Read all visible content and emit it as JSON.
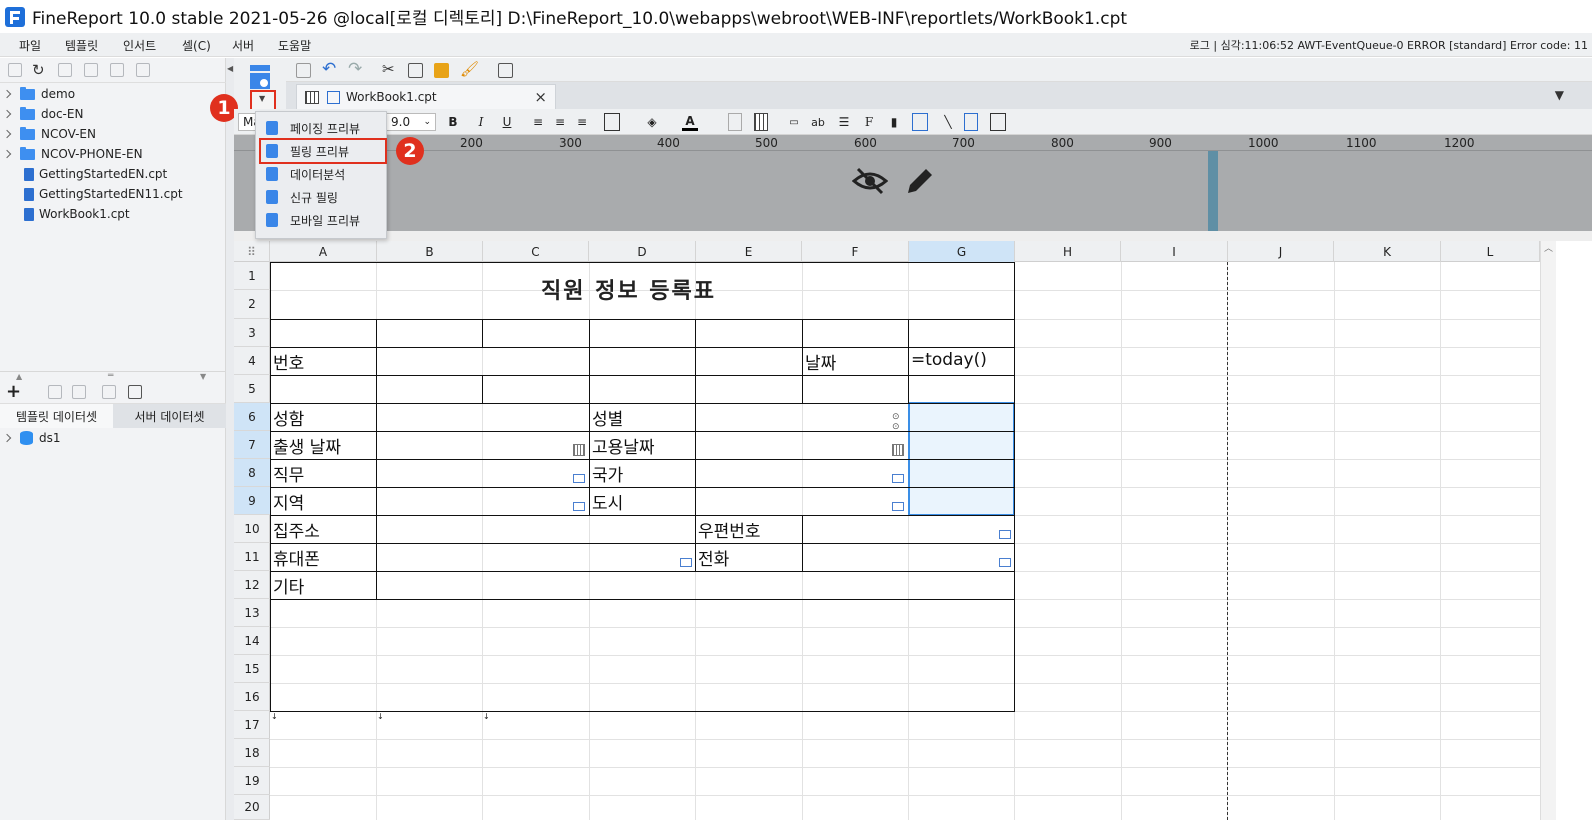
{
  "window": {
    "title": "FineReport 10.0 stable 2021-05-26 @local[로컬 디렉토리]    D:\\FineReport_10.0\\webapps\\webroot\\WEB-INF\\reportlets/WorkBook1.cpt"
  },
  "menubar": {
    "items": [
      "파일",
      "템플릿",
      "인서트",
      "셀(C)",
      "서버",
      "도움말"
    ],
    "log": "로그 | 심각:11:06:52 AWT-EventQueue-0 ERROR [standard] Error code: 11"
  },
  "file_tree": {
    "folders": [
      "demo",
      "doc-EN",
      "NCOV-EN",
      "NCOV-PHONE-EN"
    ],
    "files": [
      "GettingStartedEN.cpt",
      "GettingStartedEN11.cpt",
      "WorkBook1.cpt"
    ]
  },
  "dataset_panel": {
    "tabs": [
      "템플릿 데이터셋",
      "서버 데이터셋"
    ],
    "items": [
      "ds1"
    ]
  },
  "tab": {
    "label": "WorkBook1.cpt"
  },
  "format_bar": {
    "font": "Ma",
    "size": "9.0"
  },
  "ruler": {
    "labels": [
      "200",
      "300",
      "400",
      "500",
      "600",
      "700",
      "800",
      "900",
      "1000",
      "1100",
      "1200"
    ]
  },
  "preview_menu": {
    "items": [
      "페이징 프리뷰",
      "필링 프리뷰",
      "데이터분석",
      "신규 필링",
      "모바일 프리뷰"
    ],
    "highlighted_index": 1
  },
  "annotations": {
    "step1": "1",
    "step2": "2"
  },
  "grid": {
    "columns": [
      "A",
      "B",
      "C",
      "D",
      "E",
      "F",
      "G",
      "H",
      "I",
      "J",
      "K",
      "L"
    ],
    "rows": [
      "1",
      "2",
      "3",
      "4",
      "5",
      "6",
      "7",
      "8",
      "9",
      "10",
      "11",
      "12",
      "13",
      "14",
      "15",
      "16",
      "17",
      "18",
      "19",
      "20"
    ],
    "selected_column": "G",
    "selected_row_range": [
      "6",
      "9"
    ]
  },
  "form": {
    "title": "직원 정보 등록표",
    "labels": {
      "number": "번호",
      "date": "날짜",
      "date_formula": "=today()",
      "name": "성함",
      "gender": "성별",
      "birth": "출생 날짜",
      "hire_date": "고용날짜",
      "job": "직무",
      "country": "국가",
      "region": "지역",
      "city": "도시",
      "address": "집주소",
      "postal": "우편번호",
      "mobile": "휴대폰",
      "phone": "전화",
      "other": "기타"
    }
  }
}
